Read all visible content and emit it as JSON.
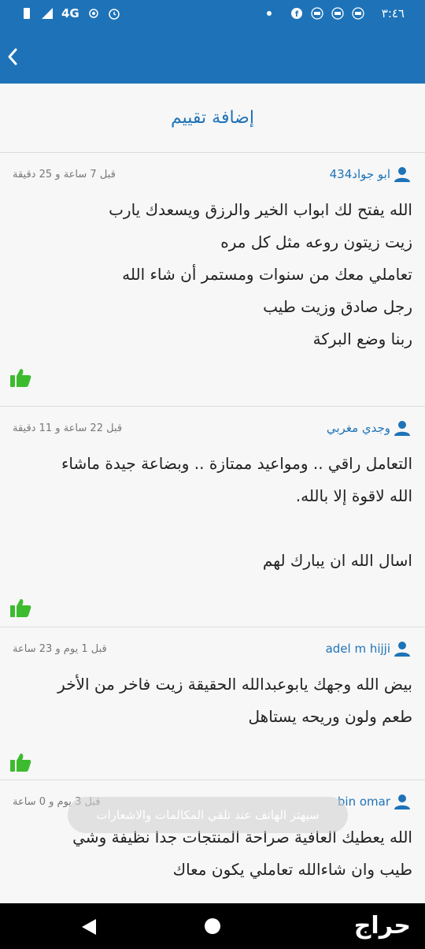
{
  "status_bar": {
    "time": "٣:٤٦",
    "network": "4G"
  },
  "app_bar": {
    "back_icon": "chevron-left-icon"
  },
  "add_review_label": "إضافة تقييم",
  "reviews": [
    {
      "user": "ابو جواد434",
      "time": "قبل 7 ساعة و 25 دقيقة",
      "lines": [
        "الله يفتح لك ابواب الخير والرزق ويسعدك يارب",
        "زيت زيتون روعه مثل كل مره",
        "تعاملي معك من سنوات ومستمر أن شاء الله",
        "رجل صادق وزيت طيب",
        "ربنا وضع البركة"
      ]
    },
    {
      "user": "وجدي مغربي",
      "time": "قبل 22 ساعة و 11 دقيقة",
      "lines": [
        "التعامل راقي .. ومواعيد ممتازة .. وبضاعة جيدة ماشاء",
        "الله لاقوة إلا بالله.",
        "",
        "اسال الله ان يبارك لهم"
      ]
    },
    {
      "user": "adel m hijji",
      "time": "قبل 1 يوم و 23 ساعة",
      "lines": [
        "بيض الله وجهك يابوعبدالله الحقيقة زيت فاخر من الأخر",
        "طعم ولون وريحه يستاهل"
      ]
    },
    {
      "user": "bin omar",
      "time": "قبل 3 يوم و 0 ساعة",
      "lines": [
        "الله يعطيك العافية صراحة المنتجات جدا نظيفة وشي",
        "طيب وان شاءالله تعاملي يكون معاك"
      ]
    }
  ],
  "toast": "سيهتز الهاتف عند تلقي المكالمات والاشعارات",
  "nav_bar": {
    "logo_text": "حراج"
  },
  "colors": {
    "primary": "#1e73b8",
    "like": "#3dbb2f",
    "text": "#222222",
    "meta": "#777777"
  }
}
